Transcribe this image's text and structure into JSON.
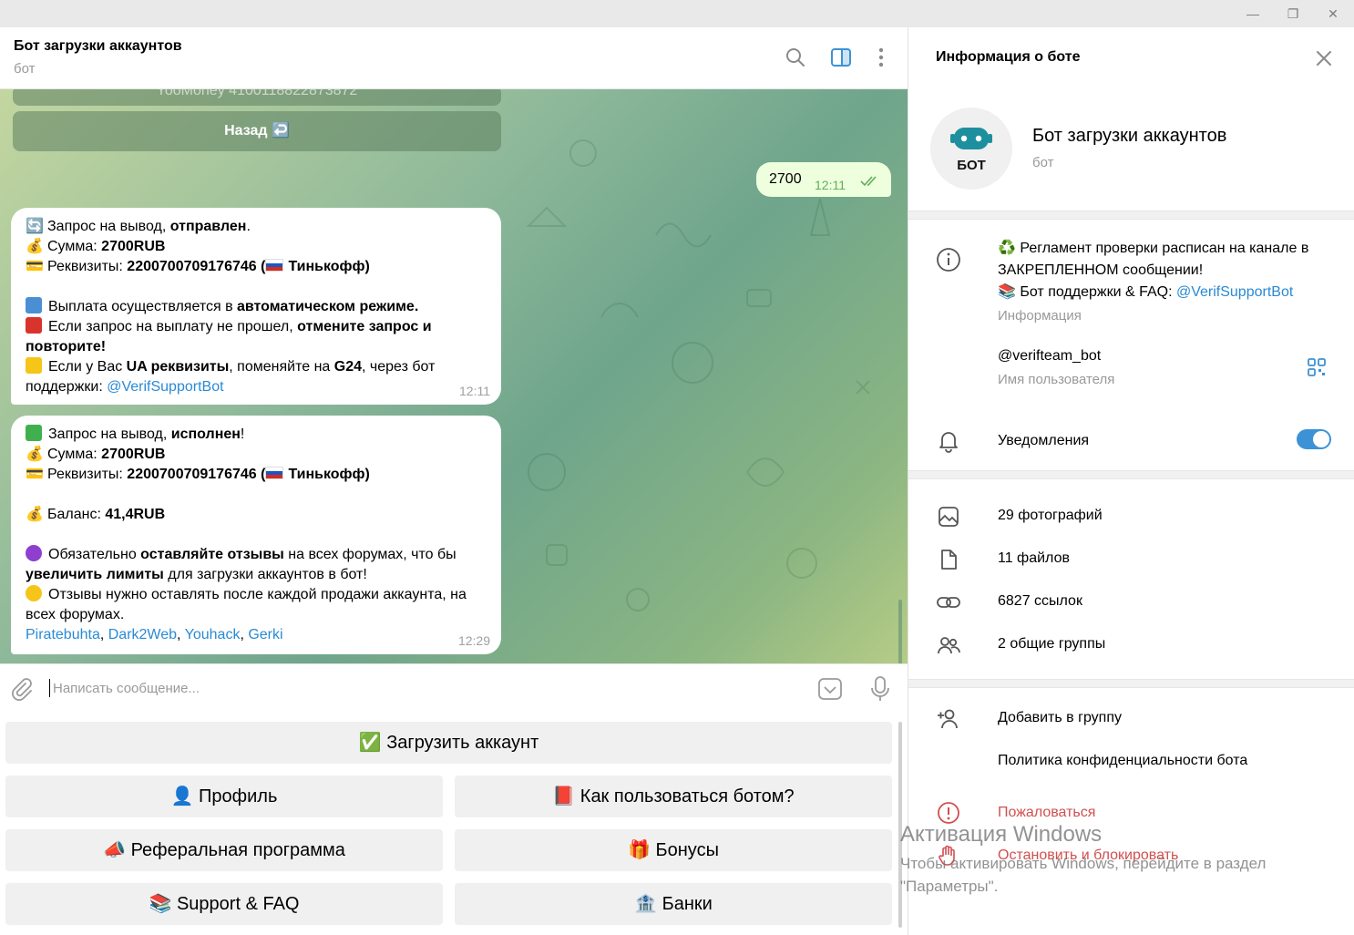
{
  "window": {
    "minimize": "—",
    "maximize": "❐",
    "close": "✕"
  },
  "chat": {
    "title": "Бот загрузки аккаунтов",
    "subtitle": "бот",
    "top_button": "YooMoney 4100118822873872",
    "back_button": "Назад ↩️",
    "outgoing": {
      "text": "2700",
      "time": "12:11"
    },
    "msg1": {
      "l1_pre": "Запрос на вывод, ",
      "l1_bold": "отправлен",
      "l1_post": ".",
      "l2_pre": "Сумма: ",
      "l2_bold": "2700RUB",
      "l3_pre": "Реквизиты: ",
      "l3_bold": "2200700709176746 (",
      "l3_bold2": "Тинькофф)",
      "l4_pre": "Выплата осуществляется в ",
      "l4_bold": "автоматическом режиме.",
      "l5_pre": "Если запрос на выплату не прошел, ",
      "l5_bold": "отмените запрос и повторите!",
      "l6_pre": "Если у Вас ",
      "l6_b1": "UA реквизиты",
      "l6_mid": ", поменяйте на ",
      "l6_b2": "G24",
      "l6_post": ", через бот поддержки: ",
      "l6_link": "@VerifSupportBot",
      "time": "12:11"
    },
    "msg2": {
      "l1_pre": "Запрос на вывод, ",
      "l1_bold": "исполнен",
      "l1_post": "!",
      "l2_pre": "Сумма: ",
      "l2_bold": "2700RUB",
      "l3_pre": "Реквизиты: ",
      "l3_bold": "2200700709176746 (",
      "l3_bold2": "Тинькофф)",
      "l4_pre": "Баланс: ",
      "l4_bold": "41,4RUB",
      "l5_pre": "Обязательно ",
      "l5_b1": "оставляйте отзывы",
      "l5_mid": " на всех форумах, что бы ",
      "l5_b2": "увеличить лимиты",
      "l5_post": " для загрузки аккаунтов в бот!",
      "l6": "Отзывы нужно оставлять после каждой продажи аккаунта, на всех форумах.",
      "links": [
        "Piratebuhta",
        "Dark2Web",
        "Youhack",
        "Gerki"
      ],
      "time": "12:29"
    }
  },
  "input": {
    "placeholder": "Написать сообщение..."
  },
  "keyboard": {
    "upload": "✅ Загрузить аккаунт",
    "profile": "👤 Профиль",
    "howto": "📕 Как пользоваться ботом?",
    "referral": "📣 Реферальная программа",
    "bonuses": "🎁 Бонусы",
    "support": "📚 Support & FAQ",
    "banks": "🏦 Банки"
  },
  "panel": {
    "header": "Информация о боте",
    "name": "Бот загрузки аккаунтов",
    "subtitle": "бот",
    "avatar_text": "БОТ",
    "info_line1": "♻️ Регламент проверки расписан на канале в ЗАКРЕПЛЕННОМ сообщении!",
    "info_line2_pre": "📚 Бот поддержки & FAQ: ",
    "info_line2_link": "@VerifSupportBot",
    "info_label": "Информация",
    "username": "@verifteam_bot",
    "username_label": "Имя пользователя",
    "notifications": "Уведомления",
    "notifications_on": true,
    "photos": "29 фотографий",
    "files": "11 файлов",
    "links": "6827 ссылок",
    "groups": "2 общие группы",
    "add_to_group": "Добавить в группу",
    "privacy": "Политика конфиденциальности бота",
    "report": "Пожаловаться",
    "block": "Остановить и блокировать"
  },
  "watermark": {
    "title": "Активация Windows",
    "subtitle": "Чтобы активировать Windows, перейдите в раздел \"Параметры\"."
  },
  "colors": {
    "accent": "#3d92d6",
    "link": "#2a8ad4",
    "danger": "#d14f4f",
    "outgoing_bubble": "#eeffde"
  }
}
